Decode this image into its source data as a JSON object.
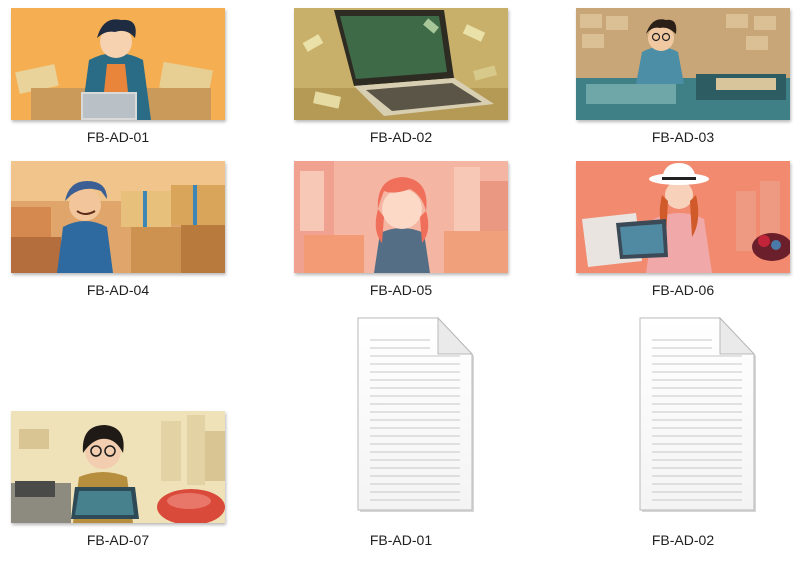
{
  "files": [
    {
      "name": "FB-AD-01",
      "type": "image",
      "icon": "image-thumbnail-icon",
      "colors": {
        "bg": "#f3a448",
        "accent": "#2a6b86"
      }
    },
    {
      "name": "FB-AD-02",
      "type": "image",
      "icon": "image-thumbnail-icon",
      "colors": {
        "bg": "#c8b06a",
        "accent": "#3d3a2e"
      }
    },
    {
      "name": "FB-AD-03",
      "type": "image",
      "icon": "image-thumbnail-icon",
      "colors": {
        "bg": "#c9a678",
        "accent": "#3f7f86"
      }
    },
    {
      "name": "FB-AD-04",
      "type": "image",
      "icon": "image-thumbnail-icon",
      "colors": {
        "bg": "#e0a56a",
        "accent": "#2e6aa0"
      }
    },
    {
      "name": "FB-AD-05",
      "type": "image",
      "icon": "image-thumbnail-icon",
      "colors": {
        "bg": "#f4b5a2",
        "accent": "#ef6f5a"
      }
    },
    {
      "name": "FB-AD-06",
      "type": "image",
      "icon": "image-thumbnail-icon",
      "colors": {
        "bg": "#f28a70",
        "accent": "#ffffff"
      }
    },
    {
      "name": "FB-AD-07",
      "type": "image",
      "icon": "image-thumbnail-icon",
      "colors": {
        "bg": "#efe1b8",
        "accent": "#46818d"
      }
    },
    {
      "name": "FB-AD-01",
      "type": "document",
      "icon": "text-document-icon"
    },
    {
      "name": "FB-AD-02",
      "type": "document",
      "icon": "text-document-icon"
    }
  ]
}
